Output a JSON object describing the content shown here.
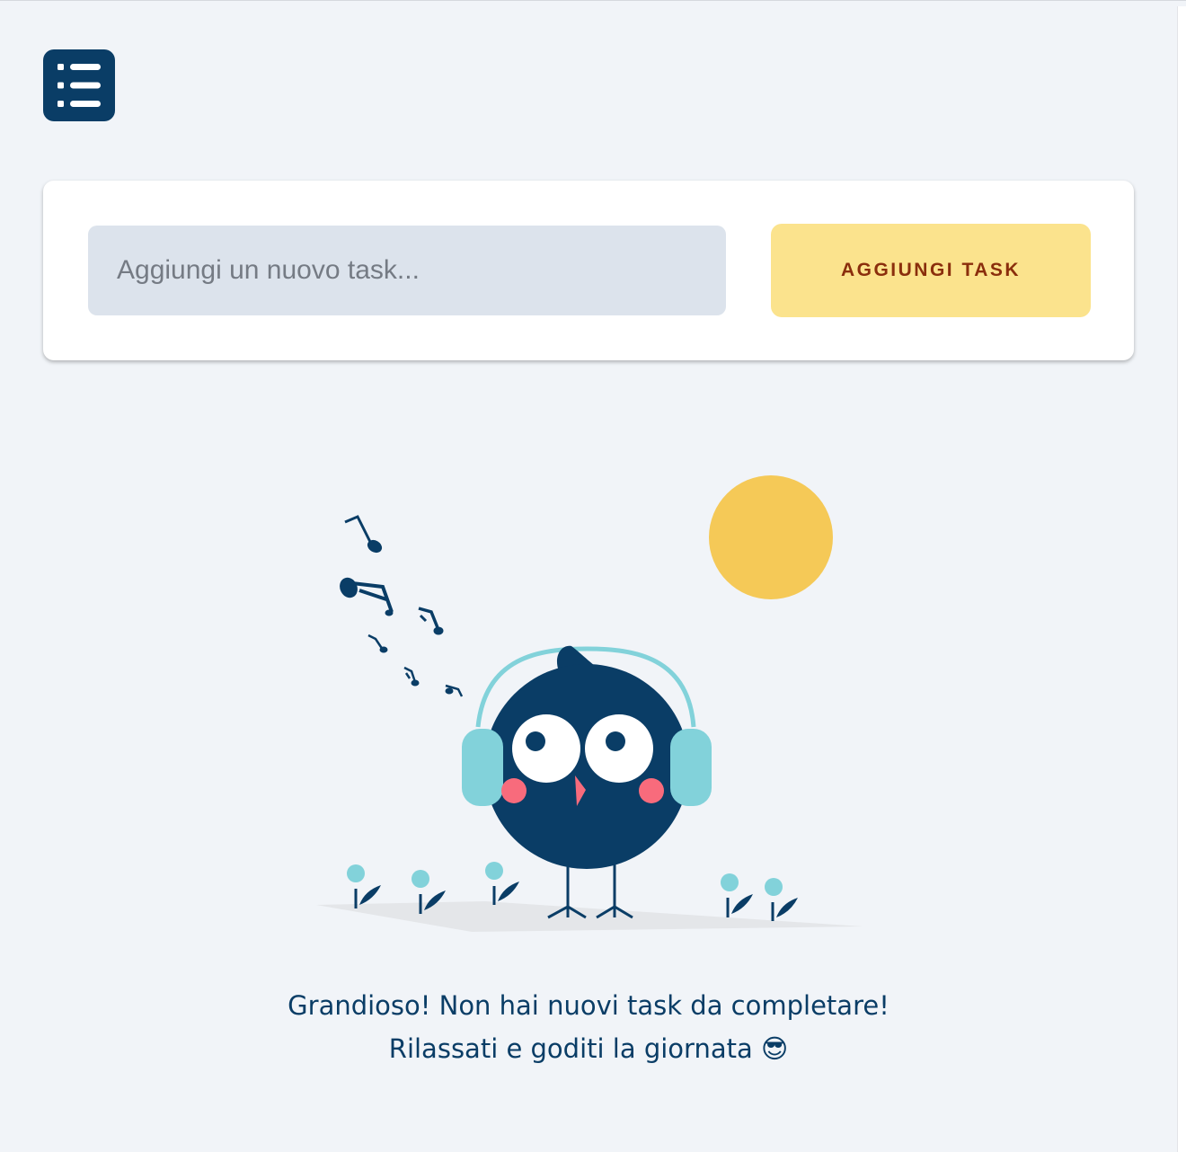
{
  "header": {
    "menu_icon": "list-icon"
  },
  "task_form": {
    "input_value": "",
    "input_placeholder": "Aggiungi un nuovo task...",
    "add_button_label": "AGGIUNGI TASK"
  },
  "empty_state": {
    "illustration": "bird-with-headphones-illustration",
    "message_line1": "Grandioso! Non hai nuovi task da completare!",
    "message_line2": "Rilassati e goditi la giornata 😎"
  },
  "colors": {
    "background": "#f1f4f8",
    "brand_dark": "#0a3d66",
    "button_yellow": "#fbe38d",
    "button_text": "#8a2e0c",
    "sun": "#f5c957",
    "accent_teal": "#82d2da",
    "cheek_pink": "#f86b7c"
  }
}
